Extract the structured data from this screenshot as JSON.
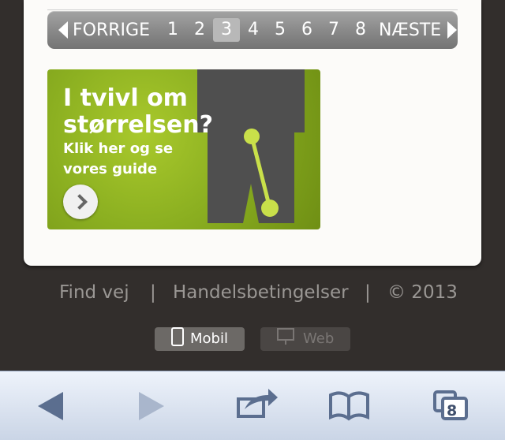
{
  "pagination": {
    "prev": "FORRIGE",
    "next": "NÆSTE",
    "pages": [
      "1",
      "2",
      "3",
      "4",
      "5",
      "6",
      "7",
      "8"
    ],
    "current": "3"
  },
  "banner": {
    "line1": "I tvivl om",
    "line2": "størrelsen?",
    "line3": "Klik her og se",
    "line4": "vores guide"
  },
  "footer": {
    "find": "Find vej",
    "sep": "|",
    "terms": "Handelsbetingelser",
    "copyright": "© 2013"
  },
  "view_mode": {
    "mobile": "Mobil",
    "web": "Web"
  },
  "browser": {
    "tab_count": "8"
  }
}
